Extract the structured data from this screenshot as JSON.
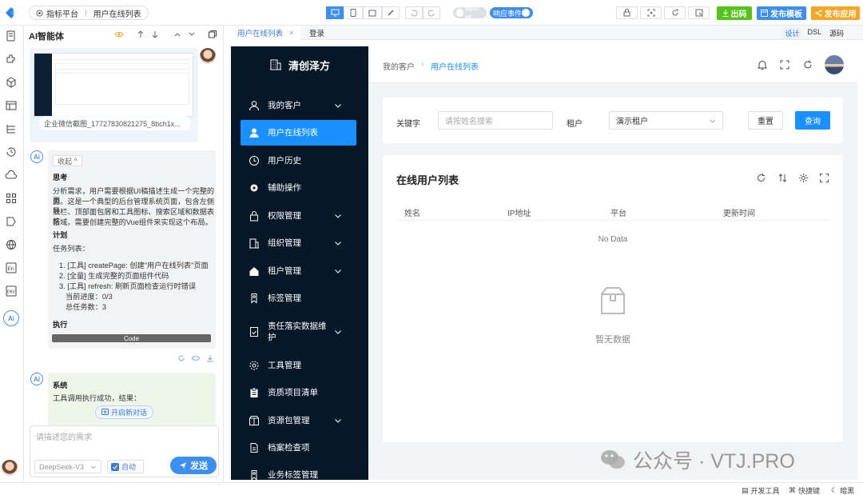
{
  "topbar": {
    "project": "指标平台",
    "page": "用户在线列表",
    "toggle_assist": "辅助线",
    "toggle_events": "响应事件",
    "btn_code": "出码",
    "btn_template": "发布模板",
    "btn_publish": "发布应用",
    "color_code": "#52c41a",
    "color_template": "#3c8ef0",
    "color_publish": "#f5a623"
  },
  "ai": {
    "title": "AI智能体",
    "attachment_caption": "企业微信截图_17727830821275_8bch1x...",
    "collapse": "收起",
    "think_heading": "思考",
    "think_lines": [
      "分析需求，用户需要根据UI稿描述生成一个完整的页",
      "面。这是一个典型的后台管理系统页面，包含左侧导",
      "航栏、顶部面包屑和工具图标、搜索区域和数据表格",
      "区域。需要创建完整的Vue组件来实现这个布局。"
    ],
    "plan_heading": "计划",
    "task_list_label": "任务列表：",
    "tasks": [
      "1. [工具] createPage: 创建\"用户在线列表\"页面",
      "2. [全量] 生成完整的页面组件代码",
      "3. [工具] refresh: 刷新页面检查运行时错误"
    ],
    "progress": "当前进度：0/3",
    "total": "总任务数：3",
    "exec_heading": "执行",
    "code_label": "Code",
    "system_heading": "系统",
    "system_line": "工具调用执行成功，结果：",
    "new_chat": "开启新对话",
    "input_placeholder": "请描述您的需求",
    "model": "DeepSeek-V3",
    "auto": "自动",
    "send": "发送"
  },
  "editor": {
    "tabs": [
      "用户在线列表",
      "登录"
    ],
    "modes": [
      "设计",
      "DSL",
      "源码"
    ]
  },
  "app": {
    "brand": "清创泽方",
    "menu": [
      {
        "label": "我的客户",
        "icon": "user-outline-icon",
        "arrow": true,
        "active": false
      },
      {
        "label": "用户在线列表",
        "icon": "user-filled-icon",
        "arrow": false,
        "active": true
      },
      {
        "label": "用户历史",
        "icon": "clock-icon",
        "arrow": false,
        "active": false
      },
      {
        "label": "辅助操作",
        "icon": "gear-filled-icon",
        "arrow": false,
        "active": false
      },
      {
        "label": "权限管理",
        "icon": "lock-icon",
        "arrow": true,
        "active": false
      },
      {
        "label": "组织管理",
        "icon": "building-icon",
        "arrow": true,
        "active": false
      },
      {
        "label": "租户管理",
        "icon": "house-icon",
        "arrow": true,
        "active": false
      },
      {
        "label": "标签管理",
        "icon": "tag-icon",
        "arrow": false,
        "active": false
      },
      {
        "label": "责任落实数据维护",
        "label2": "护",
        "icon": "doc-check-icon",
        "arrow": true,
        "active": false
      },
      {
        "label": "工具管理",
        "icon": "gear-outline-icon",
        "arrow": false,
        "active": false
      },
      {
        "label": "资质项目清单",
        "icon": "clipboard-icon",
        "arrow": false,
        "active": false
      },
      {
        "label": "资源包管理",
        "icon": "package-icon",
        "arrow": true,
        "active": false
      },
      {
        "label": "档案检查项",
        "icon": "file-icon",
        "arrow": false,
        "active": false
      },
      {
        "label": "业务标签管理",
        "icon": "tag-icon",
        "arrow": false,
        "active": false
      }
    ],
    "breadcrumb": [
      "我的客户",
      "用户在线列表"
    ],
    "search": {
      "keyword_label": "关键字",
      "keyword_placeholder": "请按姓名搜索",
      "tenant_label": "租户",
      "tenant_value": "演示租户",
      "reset": "重置",
      "query": "查询"
    },
    "table": {
      "title": "在线用户列表",
      "columns": [
        "姓名",
        "IP地址",
        "平台",
        "更新时间"
      ],
      "no_data": "No Data",
      "empty_text": "暂无数据"
    },
    "accent": "#1890ff",
    "sidebar_bg": "#061727"
  },
  "watermark": {
    "text": "公众号 · VTJ.PRO"
  },
  "statusbar": {
    "dev_tools": "开发工具",
    "shortcuts": "快捷键",
    "dark": "暗黑"
  }
}
